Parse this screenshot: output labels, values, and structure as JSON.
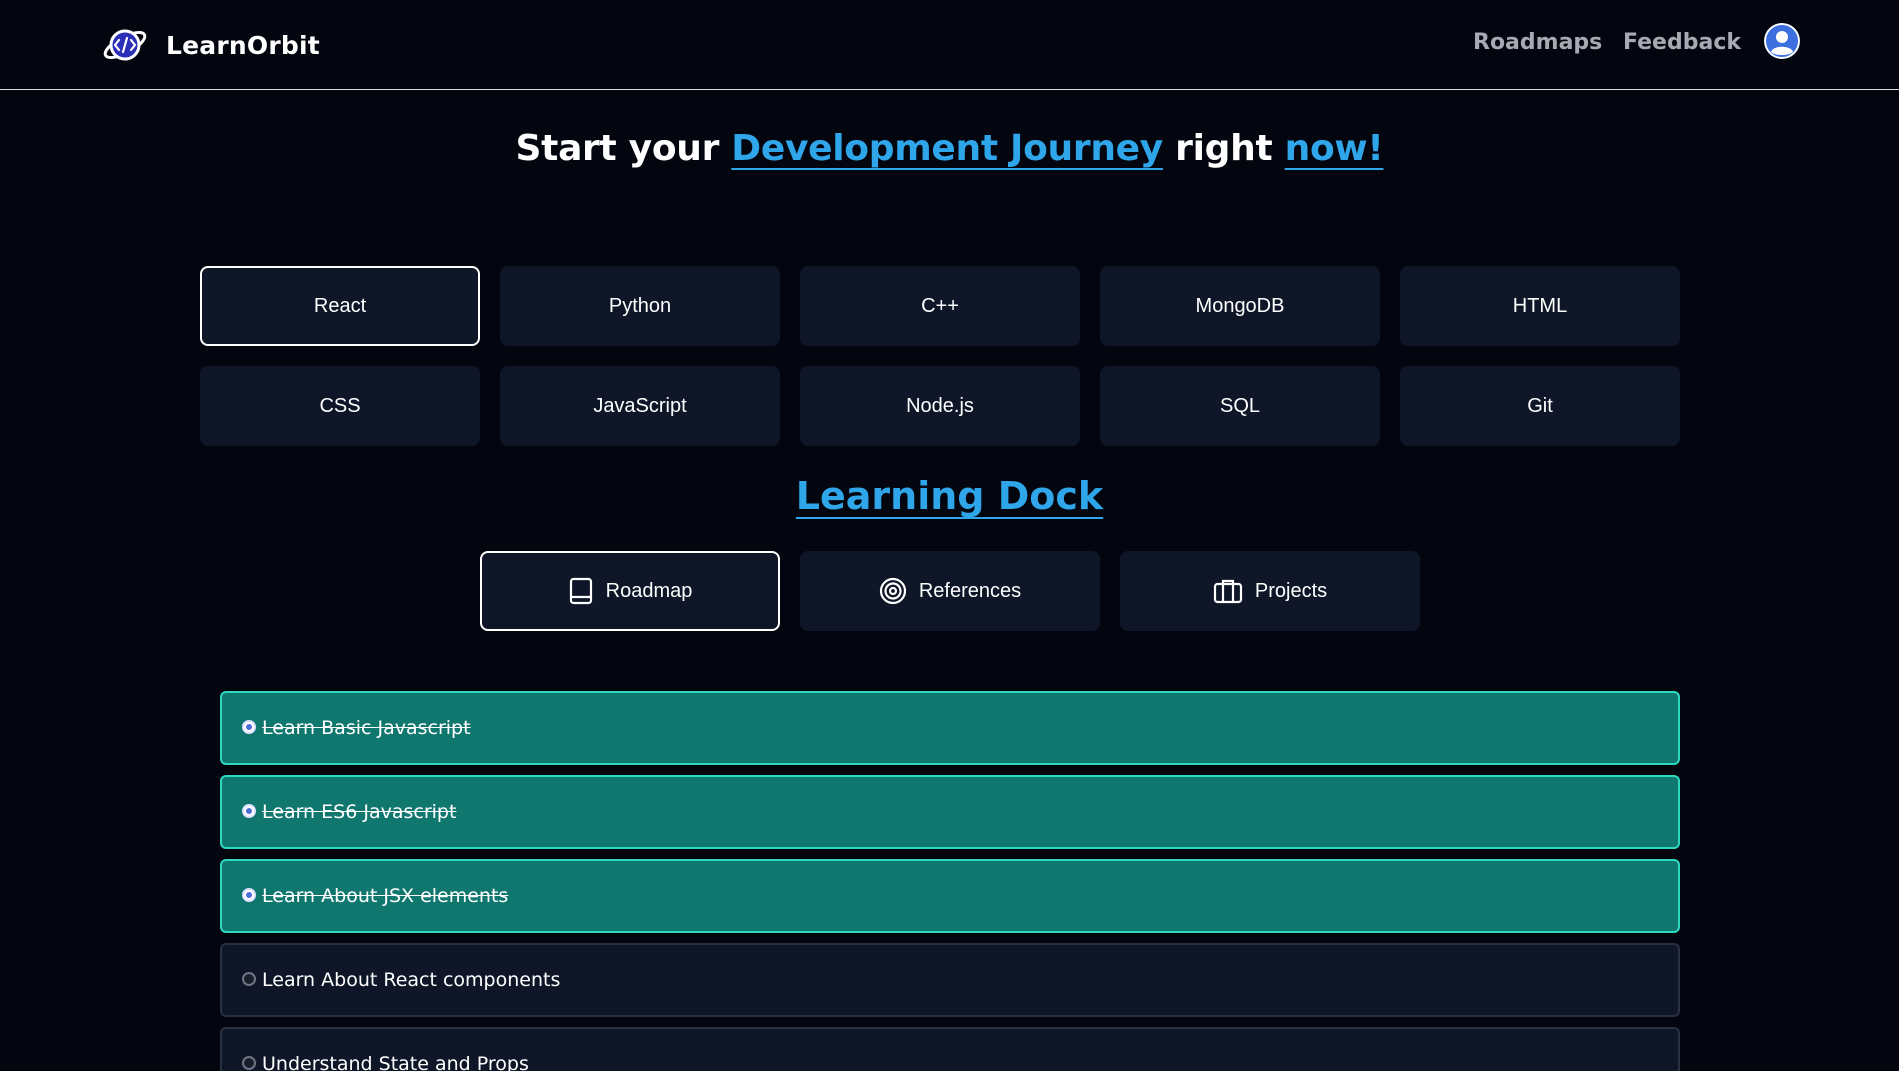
{
  "header": {
    "brand": "LearnOrbit",
    "nav": [
      {
        "label": "Roadmaps"
      },
      {
        "label": "Feedback"
      }
    ]
  },
  "hero": {
    "part1": "Start your ",
    "accent1": "Development Journey",
    "part2": " right ",
    "accent2": "now!"
  },
  "technologies": [
    {
      "label": "React",
      "active": true
    },
    {
      "label": "Python",
      "active": false
    },
    {
      "label": "C++",
      "active": false
    },
    {
      "label": "MongoDB",
      "active": false
    },
    {
      "label": "HTML",
      "active": false
    },
    {
      "label": "CSS",
      "active": false
    },
    {
      "label": "JavaScript",
      "active": false
    },
    {
      "label": "Node.js",
      "active": false
    },
    {
      "label": "SQL",
      "active": false
    },
    {
      "label": "Git",
      "active": false
    }
  ],
  "dock": {
    "title": "Learning Dock",
    "tabs": [
      {
        "label": "Roadmap",
        "icon": "book-icon",
        "active": true
      },
      {
        "label": "References",
        "icon": "target-icon",
        "active": false
      },
      {
        "label": "Projects",
        "icon": "briefcase-icon",
        "active": false
      }
    ]
  },
  "roadmap": [
    {
      "label": "Learn Basic Javascript",
      "done": true
    },
    {
      "label": "Learn ES6 Javascript",
      "done": true
    },
    {
      "label": "Learn About JSX elements",
      "done": true
    },
    {
      "label": "Learn About React components",
      "done": false
    },
    {
      "label": "Understand State and Props",
      "done": false
    }
  ],
  "colors": {
    "background": "#03060f",
    "card": "#0e1627",
    "accent": "#2fa6ea",
    "done": "#10776f",
    "doneBorder": "#2ed8bf"
  }
}
